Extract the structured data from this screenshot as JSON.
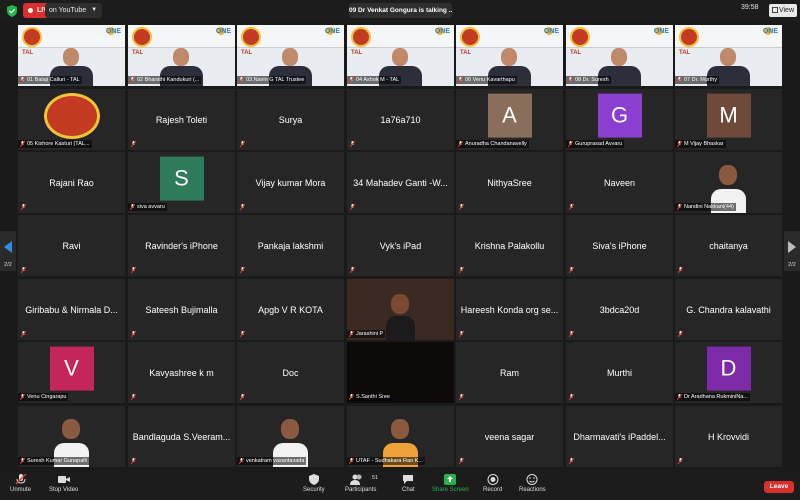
{
  "top_bar": {
    "live_label": "LIVE",
    "stream_label": "on YouTube",
    "speaker_banner": "09 Dr Venkat Gongura is talking ...",
    "timer": "39:58",
    "view_label": "View"
  },
  "banner_text": {
    "tal": "TAL",
    "one": "ONE"
  },
  "pagination": {
    "left": "2/2",
    "right": "2/2"
  },
  "tiles": [
    {
      "kind": "video",
      "label": "01 Balaji Calluri - TAL",
      "name": ""
    },
    {
      "kind": "video",
      "label": "02 Bharathi Kandukuri (...",
      "name": ""
    },
    {
      "kind": "video",
      "label": "03.Navin G TAL Trustee",
      "name": ""
    },
    {
      "kind": "video",
      "label": "04 Ashok M - TAL",
      "name": ""
    },
    {
      "kind": "video",
      "label": "06 Venu Kavarthapu",
      "name": ""
    },
    {
      "kind": "video",
      "label": "08 Dr. Suresh",
      "name": ""
    },
    {
      "kind": "video",
      "label": "07 Dr. Murthy",
      "name": ""
    },
    {
      "kind": "logo",
      "label": "05 Kishore Kasturi (TAL...",
      "name": ""
    },
    {
      "kind": "name",
      "label": "",
      "name": "Rajesh Toleti"
    },
    {
      "kind": "name",
      "label": "",
      "name": "Surya"
    },
    {
      "kind": "name",
      "label": "",
      "name": "1a76a710"
    },
    {
      "kind": "avatar",
      "label": "Anuradha Chandanavelly",
      "name": "A",
      "color": "#8a6e5c"
    },
    {
      "kind": "avatar",
      "label": "Guruprasad Avvaru",
      "name": "G",
      "color": "#8a3fd1"
    },
    {
      "kind": "avatar",
      "label": "M Vijay Bhaskar",
      "name": "M",
      "color": "#6e4a3a"
    },
    {
      "kind": "name",
      "label": "",
      "name": "Rajani Rao"
    },
    {
      "kind": "avatar",
      "label": "siva avvaru",
      "name": "S",
      "color": "#2e7c5b"
    },
    {
      "kind": "name",
      "label": "",
      "name": "Vijay kumar Mora"
    },
    {
      "kind": "name",
      "label": "",
      "name": "34 Mahadev Ganti -W..."
    },
    {
      "kind": "name",
      "label": "",
      "name": "NithyaSree"
    },
    {
      "kind": "name",
      "label": "",
      "name": "Naveen"
    },
    {
      "kind": "photo",
      "label": "Nandini Nakkani(44)",
      "name": ""
    },
    {
      "kind": "name",
      "label": "",
      "name": "Ravi"
    },
    {
      "kind": "name",
      "label": "",
      "name": "Ravinder's iPhone"
    },
    {
      "kind": "name",
      "label": "",
      "name": "Pankaja lakshmi"
    },
    {
      "kind": "name",
      "label": "",
      "name": "Vyk's iPad"
    },
    {
      "kind": "name",
      "label": "",
      "name": "Krishna Palakollu"
    },
    {
      "kind": "name",
      "label": "",
      "name": "Siva's iPhone"
    },
    {
      "kind": "name",
      "label": "",
      "name": "chaitanya"
    },
    {
      "kind": "name",
      "label": "",
      "name": "Giribabu & Nirmala D..."
    },
    {
      "kind": "name",
      "label": "",
      "name": "Sateesh Bujimalla"
    },
    {
      "kind": "name",
      "label": "",
      "name": "Apgb V R KOTA"
    },
    {
      "kind": "video",
      "label": "Jarashini P",
      "name": ""
    },
    {
      "kind": "name",
      "label": "",
      "name": "Hareesh Konda org se..."
    },
    {
      "kind": "name",
      "label": "",
      "name": "3bdca20d"
    },
    {
      "kind": "name",
      "label": "",
      "name": "G. Chandra kalavathi"
    },
    {
      "kind": "avatar",
      "label": "Venu Cingarapu",
      "name": "V",
      "color": "#c2265a"
    },
    {
      "kind": "name",
      "label": "",
      "name": "Kavyashree k m"
    },
    {
      "kind": "name",
      "label": "",
      "name": "Doc"
    },
    {
      "kind": "dark",
      "label": "S.Santhi Sree",
      "name": ""
    },
    {
      "kind": "name",
      "label": "",
      "name": "Ram"
    },
    {
      "kind": "name",
      "label": "",
      "name": "Murthi"
    },
    {
      "kind": "avatar",
      "label": "Dr Aradhana RukminiNa...",
      "name": "D",
      "color": "#7c2aa8"
    },
    {
      "kind": "photo",
      "label": "Suresh Kumar Gunapalli",
      "name": ""
    },
    {
      "kind": "name",
      "label": "",
      "name": "Bandlaguda S.Veeram..."
    },
    {
      "kind": "photo",
      "label": "venkatram vasantavada",
      "name": ""
    },
    {
      "kind": "photo",
      "label": "UTAF - Sudhakara Rao K...",
      "name": ""
    },
    {
      "kind": "name",
      "label": "",
      "name": "veena sagar"
    },
    {
      "kind": "name",
      "label": "",
      "name": "Dharmavati's iPaddel..."
    },
    {
      "kind": "name",
      "label": "",
      "name": "H Krovvidi"
    }
  ],
  "toolbar": {
    "unmute": "Unmute",
    "stop_video": "Stop Video",
    "security": "Security",
    "participants": "Participants",
    "participants_count": "51",
    "chat": "Chat",
    "share": "Share Screen",
    "record": "Record",
    "reactions": "Reactions",
    "leave": "Leave"
  },
  "colors": {
    "accent_red": "#d9302e",
    "share_green": "#27b34a",
    "tile_bg": "#262626"
  }
}
